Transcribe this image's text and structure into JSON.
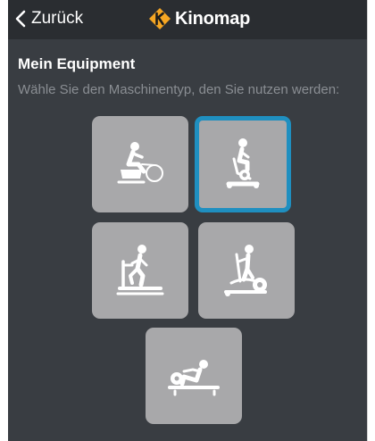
{
  "nav": {
    "back_label": "Zurück",
    "brand_name": "Kinomap",
    "brand_color": "#f5a623"
  },
  "header": {
    "title": "Mein Equipment",
    "subtitle": "Wähle Sie den Maschinentyp, den Sie nutzen werden:"
  },
  "machines": [
    {
      "icon": "bike-trainer-icon",
      "selected": false
    },
    {
      "icon": "exercise-bike-icon",
      "selected": true
    },
    {
      "icon": "treadmill-icon",
      "selected": false
    },
    {
      "icon": "elliptical-icon",
      "selected": false
    },
    {
      "icon": "rowing-machine-icon",
      "selected": false
    }
  ],
  "colors": {
    "background": "#393d42",
    "navbar": "#2a2d31",
    "tile": "#a8a8aa",
    "selected_border": "#1f8fc0"
  }
}
